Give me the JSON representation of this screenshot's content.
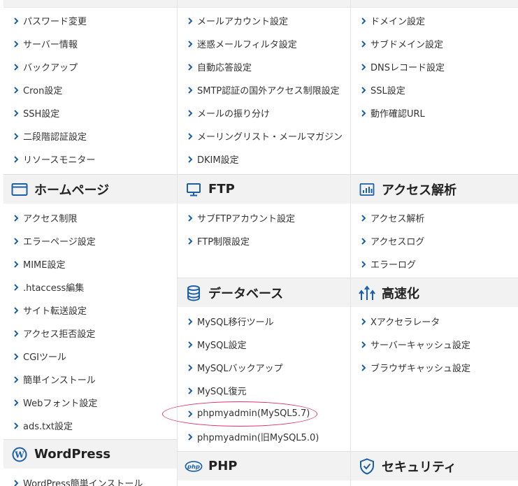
{
  "columns": [
    {
      "sections": [
        {
          "title": "",
          "icon": "",
          "items": [
            "パスワード変更",
            "サーバー情報",
            "バックアップ",
            "Cron設定",
            "SSH設定",
            "二段階認証設定",
            "リソースモニター"
          ]
        },
        {
          "title": "ホームページ",
          "icon": "browser-window-icon",
          "items": [
            "アクセス制限",
            "エラーページ設定",
            "MIME設定",
            ".htaccess編集",
            "サイト転送設定",
            "アクセス拒否設定",
            "CGIツール",
            "簡単インストール",
            "Webフォント設定",
            "ads.txt設定"
          ]
        },
        {
          "title": "WordPress",
          "icon": "wordpress-icon",
          "items": [
            "WordPress簡単インストール"
          ]
        }
      ]
    },
    {
      "sections": [
        {
          "title": "",
          "icon": "",
          "items": [
            "メールアカウント設定",
            "迷惑メールフィルタ設定",
            "自動応答設定",
            "SMTP認証の国外アクセス制限設定",
            "メールの振り分け",
            "メーリングリスト・メールマガジン",
            "DKIM設定"
          ]
        },
        {
          "title": "FTP",
          "icon": "monitor-icon",
          "items": [
            "サブFTPアカウント設定",
            "FTP制限設定"
          ]
        },
        {
          "title": "データベース",
          "icon": "database-icon",
          "items": [
            "MySQL移行ツール",
            "MySQL設定",
            "MySQLバックアップ",
            "MySQL復元",
            "phpmyadmin(MySQL5.7)",
            "phpmyadmin(旧MySQL5.0)"
          ]
        },
        {
          "title": "PHP",
          "icon": "php-icon",
          "items": []
        }
      ]
    },
    {
      "sections": [
        {
          "title": "",
          "icon": "",
          "items": [
            "ドメイン設定",
            "サブドメイン設定",
            "DNSレコード設定",
            "SSL設定",
            "動作確認URL"
          ]
        },
        {
          "title": "アクセス解析",
          "icon": "bar-chart-icon",
          "items": [
            "アクセス解析",
            "アクセスログ",
            "エラーログ"
          ]
        },
        {
          "title": "高速化",
          "icon": "speed-arrows-icon",
          "items": [
            "Xアクセラレータ",
            "サーバーキャッシュ設定",
            "ブラウザキャッシュ設定"
          ]
        },
        {
          "title": "セキュリティ",
          "icon": "shield-icon",
          "items": []
        }
      ]
    }
  ],
  "colors": {
    "accent": "#1a73b8",
    "header_bg": "#f2f2f2",
    "highlight": "#d9366b"
  }
}
